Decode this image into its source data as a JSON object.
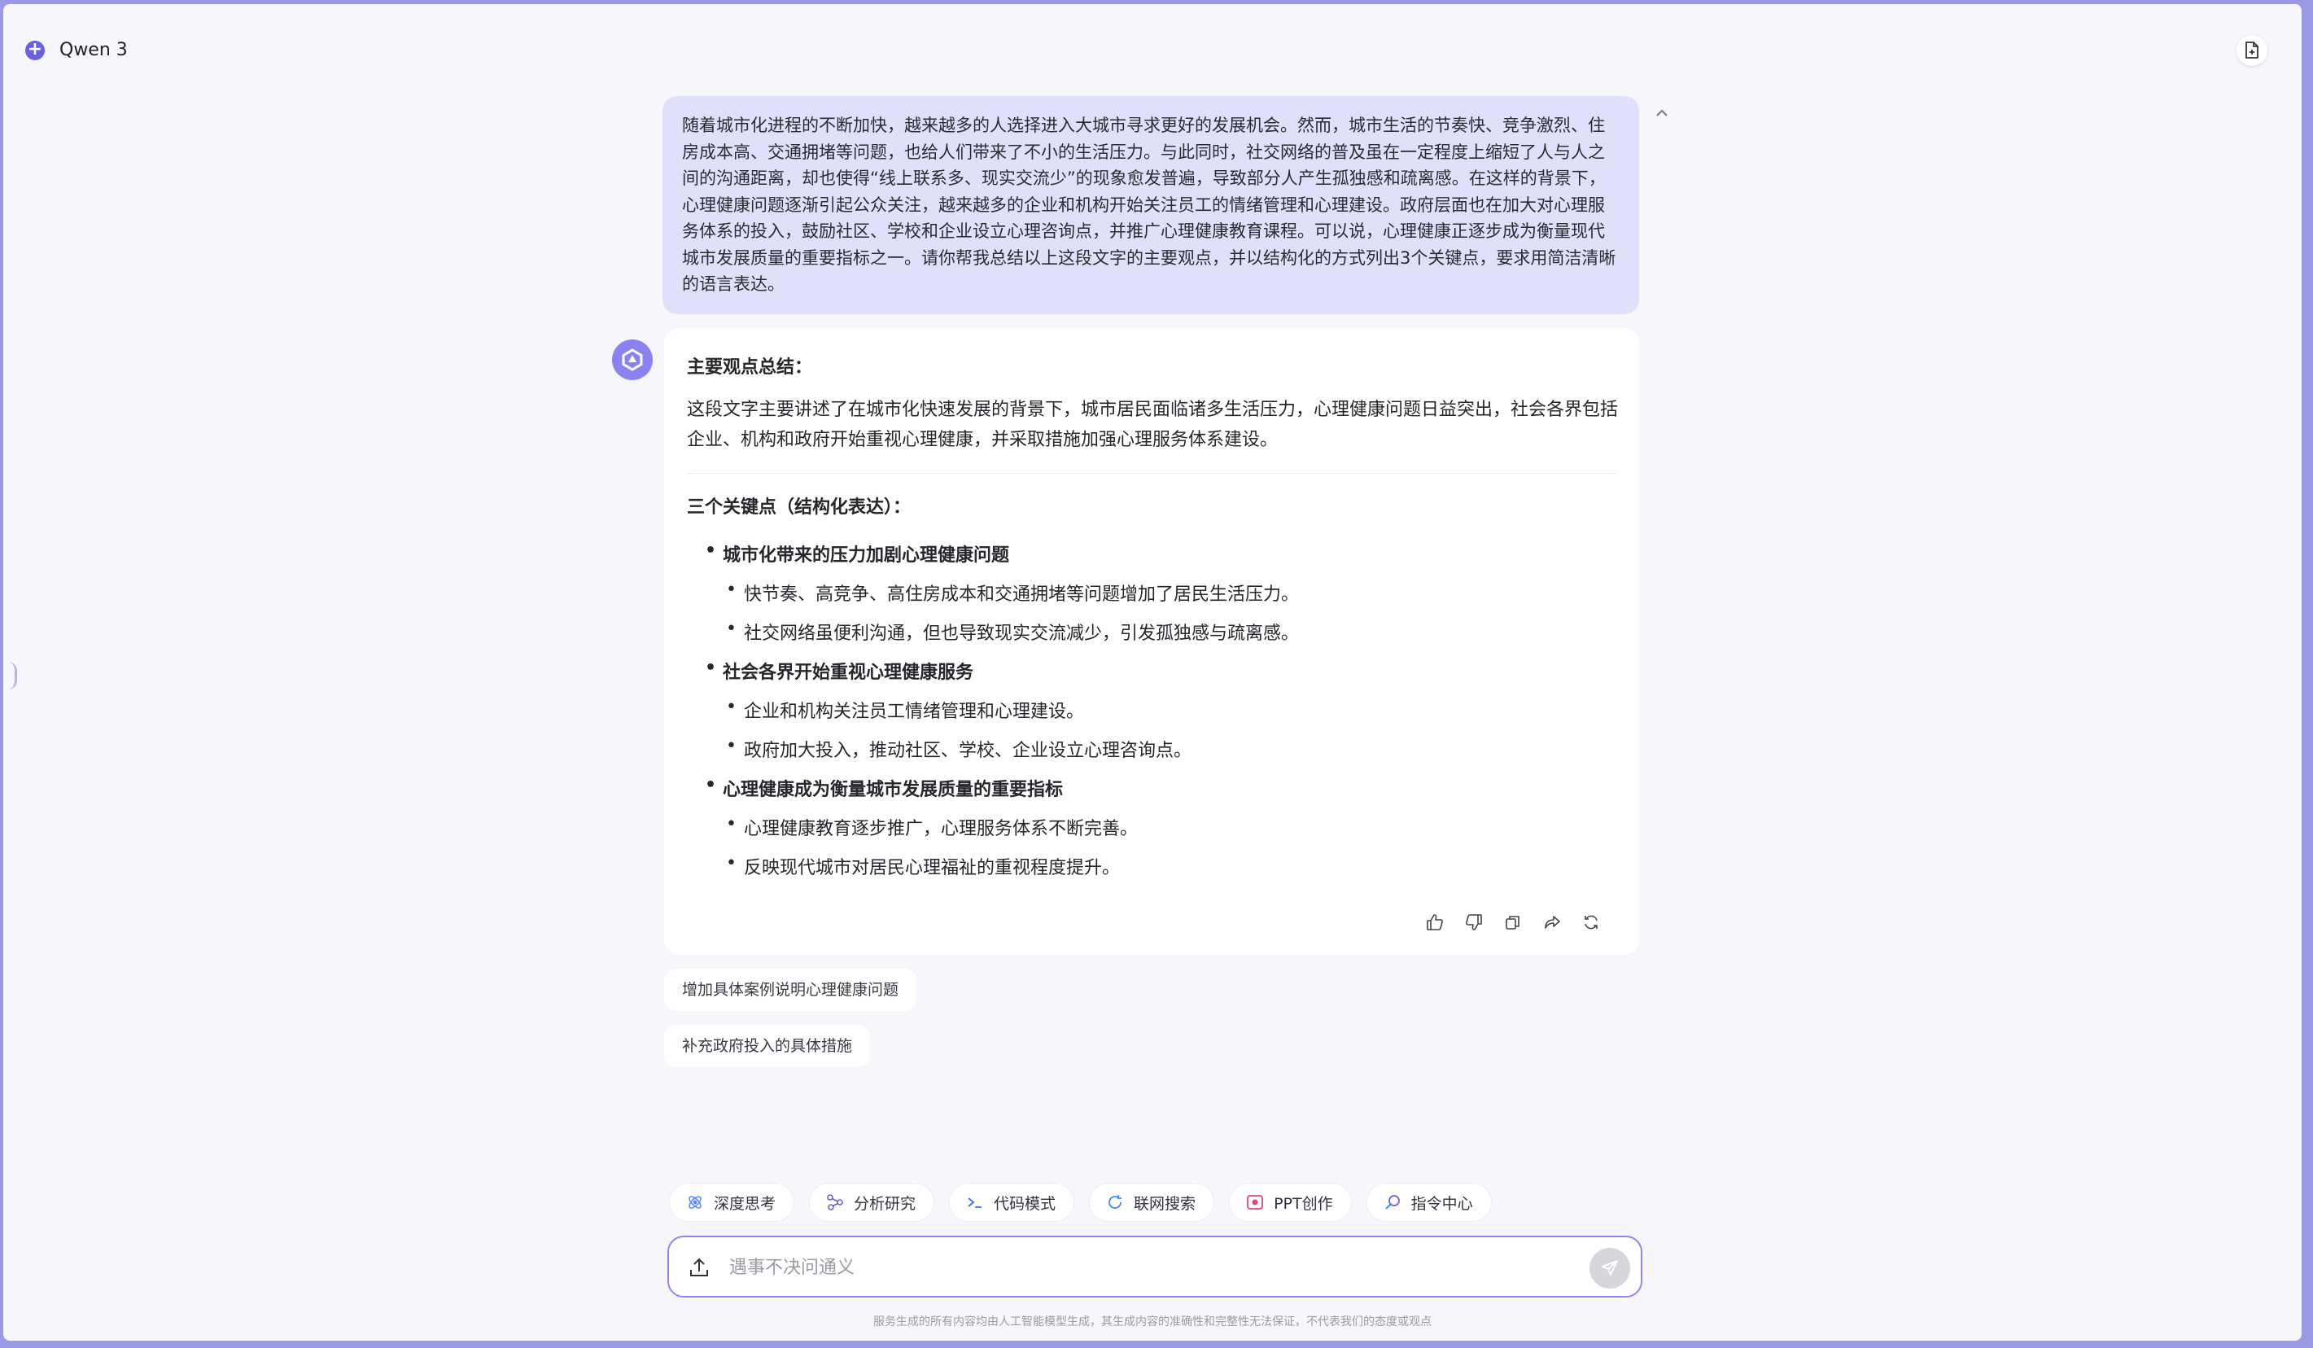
{
  "header": {
    "model_name": "Qwen 3"
  },
  "user_message": "随着城市化进程的不断加快，越来越多的人选择进入大城市寻求更好的发展机会。然而，城市生活的节奏快、竞争激烈、住房成本高、交通拥堵等问题，也给人们带来了不小的生活压力。与此同时，社交网络的普及虽在一定程度上缩短了人与人之间的沟通距离，却也使得“线上联系多、现实交流少”的现象愈发普遍，导致部分人产生孤独感和疏离感。在这样的背景下，心理健康问题逐渐引起公众关注，越来越多的企业和机构开始关注员工的情绪管理和心理建设。政府层面也在加大对心理服务体系的投入，鼓励社区、学校和企业设立心理咨询点，并推广心理健康教育课程。可以说，心理健康正逐步成为衡量现代城市发展质量的重要指标之一。请你帮我总结以上这段文字的主要观点，并以结构化的方式列出3个关键点，要求用简洁清晰的语言表达。",
  "answer": {
    "heading": "主要观点总结：",
    "summary": "这段文字主要讲述了在城市化快速发展的背景下，城市居民面临诸多生活压力，心理健康问题日益突出，社会各界包括企业、机构和政府开始重视心理健康，并采取措施加强心理服务体系建设。",
    "points_heading": "三个关键点（结构化表达）：",
    "points": [
      {
        "title": "城市化带来的压力加剧心理健康问题",
        "items": [
          "快节奏、高竞争、高住房成本和交通拥堵等问题增加了居民生活压力。",
          "社交网络虽便利沟通，但也导致现实交流减少，引发孤独感与疏离感。"
        ]
      },
      {
        "title": "社会各界开始重视心理健康服务",
        "items": [
          "企业和机构关注员工情绪管理和心理建设。",
          "政府加大投入，推动社区、学校、企业设立心理咨询点。"
        ]
      },
      {
        "title": "心理健康成为衡量城市发展质量的重要指标",
        "items": [
          "心理健康教育逐步推广，心理服务体系不断完善。",
          "反映现代城市对居民心理福祉的重视程度提升。"
        ]
      }
    ]
  },
  "suggestions": [
    "增加具体案例说明心理健康问题",
    "补充政府投入的具体措施"
  ],
  "tools": [
    "深度思考",
    "分析研究",
    "代码模式",
    "联网搜索",
    "PPT创作",
    "指令中心"
  ],
  "input": {
    "placeholder": "遇事不决问通义",
    "value": ""
  },
  "disclaimer": "服务生成的所有内容均由人工智能模型生成，其生成内容的准确性和完整性无法保证，不代表我们的态度或观点",
  "colors": {
    "accent": "#6a60e0",
    "user_bubble": "#e1e0fa",
    "border": "#8f87f0"
  }
}
